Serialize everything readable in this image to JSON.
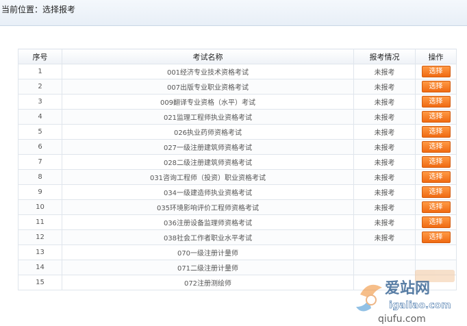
{
  "breadcrumb": {
    "text": "当前位置：选择报考"
  },
  "table": {
    "headers": [
      "序号",
      "考试名称",
      "报考情况",
      "操作"
    ],
    "rows": [
      {
        "no": "1",
        "name": "001经济专业技术资格考试",
        "status": "未报考",
        "action": "选择"
      },
      {
        "no": "2",
        "name": "007出版专业职业资格考试",
        "status": "未报考",
        "action": "选择"
      },
      {
        "no": "3",
        "name": "009翻译专业资格（水平）考试",
        "status": "未报考",
        "action": "选择"
      },
      {
        "no": "4",
        "name": "021监理工程师执业资格考试",
        "status": "未报考",
        "action": "选择"
      },
      {
        "no": "5",
        "name": "026执业药师资格考试",
        "status": "未报考",
        "action": "选择"
      },
      {
        "no": "6",
        "name": "027一级注册建筑师资格考试",
        "status": "未报考",
        "action": "选择"
      },
      {
        "no": "7",
        "name": "028二级注册建筑师资格考试",
        "status": "未报考",
        "action": "选择"
      },
      {
        "no": "8",
        "name": "031咨询工程师（投资）职业资格考试",
        "status": "未报考",
        "action": "选择"
      },
      {
        "no": "9",
        "name": "034一级建造师执业资格考试",
        "status": "未报考",
        "action": "选择"
      },
      {
        "no": "10",
        "name": "035环境影响评价工程师资格考试",
        "status": "未报考",
        "action": "选择"
      },
      {
        "no": "11",
        "name": "036注册设备监理师资格考试",
        "status": "未报考",
        "action": "选择"
      },
      {
        "no": "12",
        "name": "038社会工作者职业水平考试",
        "status": "未报考",
        "action": "选择"
      },
      {
        "no": "13",
        "name": "070一级注册计量师",
        "status": "",
        "action": ""
      },
      {
        "no": "14",
        "name": "071二级注册计量师",
        "status": "",
        "action": ""
      },
      {
        "no": "15",
        "name": "072注册测绘师",
        "status": "",
        "action": ""
      }
    ]
  },
  "watermark": {
    "line1": "爱站网",
    "line2": "igaliao.com",
    "line3": "qiufu.com"
  },
  "colors": {
    "button": "#f47a1f",
    "link": "#3d5f8a",
    "header_bar": "#e8eff7",
    "border": "#dfe5ec"
  }
}
